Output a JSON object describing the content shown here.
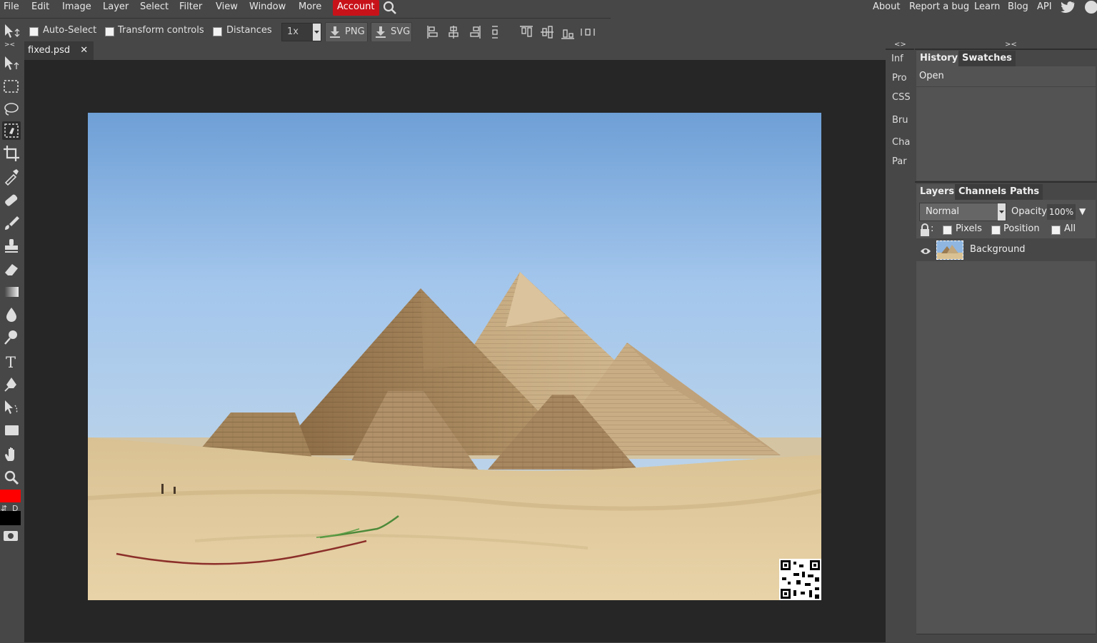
{
  "menubar": {
    "items": [
      "File",
      "Edit",
      "Image",
      "Layer",
      "Select",
      "Filter",
      "View",
      "Window",
      "More"
    ],
    "account": "Account",
    "links": [
      "About",
      "Report a bug",
      "Learn",
      "Blog",
      "API"
    ]
  },
  "options": {
    "auto_select": "Auto-Select",
    "transform_controls": "Transform controls",
    "distances": "Distances",
    "zoom_value": "1x",
    "export_png": "PNG",
    "export_svg": "SVG"
  },
  "document": {
    "tab_name": "fixed.psd",
    "close_glyph": "✕"
  },
  "mini_panel": {
    "items": [
      "Inf",
      "Pro",
      "CSS",
      "Bru",
      "Cha",
      "Par"
    ],
    "toggle": "<>"
  },
  "history_panel": {
    "tabs": [
      "History",
      "Swatches"
    ],
    "entries": [
      "Open"
    ],
    "toggle": "><"
  },
  "layers_panel": {
    "tabs": [
      "Layers",
      "Channels",
      "Paths"
    ],
    "blend_mode": "Normal",
    "opacity_label": "Opacity:",
    "opacity_value": "100%",
    "lock_label": ":",
    "lock_pixels": "Pixels",
    "lock_position": "Position",
    "lock_all": "All",
    "layers": [
      "Background"
    ]
  },
  "colors": {
    "foreground": "#ff0000",
    "background": "#000000",
    "accent_account": "#c8121a"
  },
  "tool_toggle": "><",
  "swap_label": "D"
}
